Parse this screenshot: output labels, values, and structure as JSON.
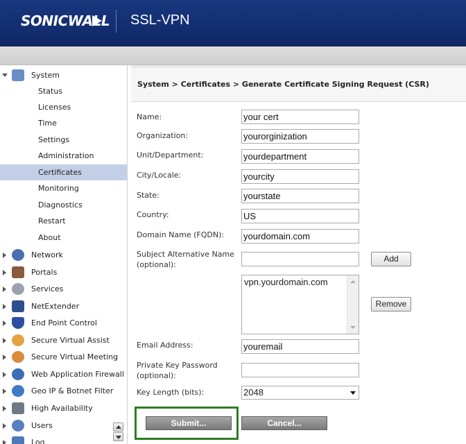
{
  "header": {
    "brand": "SONICWALL",
    "product": "SSL-VPN"
  },
  "sidebar": {
    "system_label": "System",
    "system_items": [
      "Status",
      "Licenses",
      "Time",
      "Settings",
      "Administration",
      "Certificates",
      "Monitoring",
      "Diagnostics",
      "Restart",
      "About"
    ],
    "selected": "Certificates",
    "sections": [
      "Network",
      "Portals",
      "Services",
      "NetExtender",
      "End Point Control",
      "Secure Virtual Assist",
      "Secure Virtual Meeting",
      "Web Application Firewall",
      "Geo IP & Botnet Filter",
      "High Availability",
      "Users",
      "Log"
    ]
  },
  "main": {
    "breadcrumb": "System > Certificates > Generate Certificate Signing Request (CSR)",
    "fields": {
      "name_label": "Name:",
      "name_value": "your cert",
      "org_label": "Organization:",
      "org_value": "yourorginization",
      "unit_label": "Unit/Department:",
      "unit_value": "yourdepartment",
      "city_label": "City/Locale:",
      "city_value": "yourcity",
      "state_label": "State:",
      "state_value": "yourstate",
      "country_label": "Country:",
      "country_value": "US",
      "domain_label": "Domain Name (FQDN):",
      "domain_value": "yourdomain.com",
      "san_label_1": "Subject Alternative Name",
      "san_label_2": "(optional):",
      "san_value": "",
      "san_list_item": "vpn.yourdomain.com",
      "email_label": "Email Address:",
      "email_value": "youremail",
      "pkp_label_1": "Private Key Password",
      "pkp_label_2": "(optional):",
      "pkp_value": "",
      "key_label": "Key Length (bits):",
      "key_value": "2048"
    },
    "add_button": "Add",
    "remove_button": "Remove",
    "submit_button": "Submit...",
    "cancel_button": "Cancel...",
    "highlight_color": "#2d7d20"
  }
}
